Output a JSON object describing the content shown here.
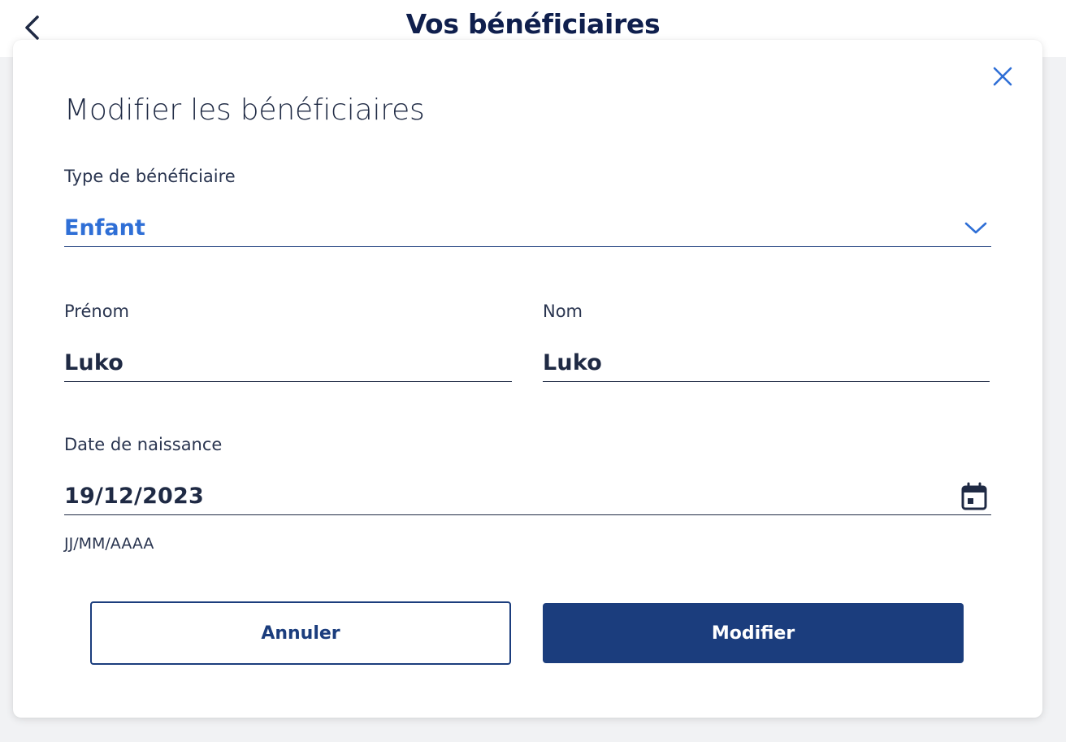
{
  "header": {
    "title": "Vos bénéficiaires"
  },
  "modal": {
    "title": "Modifier les bénéficiaires",
    "type": {
      "label": "Type de bénéficiaire",
      "value": "Enfant"
    },
    "firstname": {
      "label": "Prénom",
      "value": "Luko"
    },
    "lastname": {
      "label": "Nom",
      "value": "Luko"
    },
    "birthdate": {
      "label": "Date de naissance",
      "value": "19/12/2023",
      "hint": "JJ/MM/AAAA"
    },
    "actions": {
      "cancel_label": "Annuler",
      "submit_label": "Modifier"
    }
  },
  "colors": {
    "primary": "#1b3d7d",
    "accent": "#2f6fd6",
    "text": "#1f2a44"
  },
  "icons": {
    "back": "chevron-left-icon",
    "close": "close-icon",
    "dropdown": "chevron-down-icon",
    "calendar": "calendar-icon"
  }
}
